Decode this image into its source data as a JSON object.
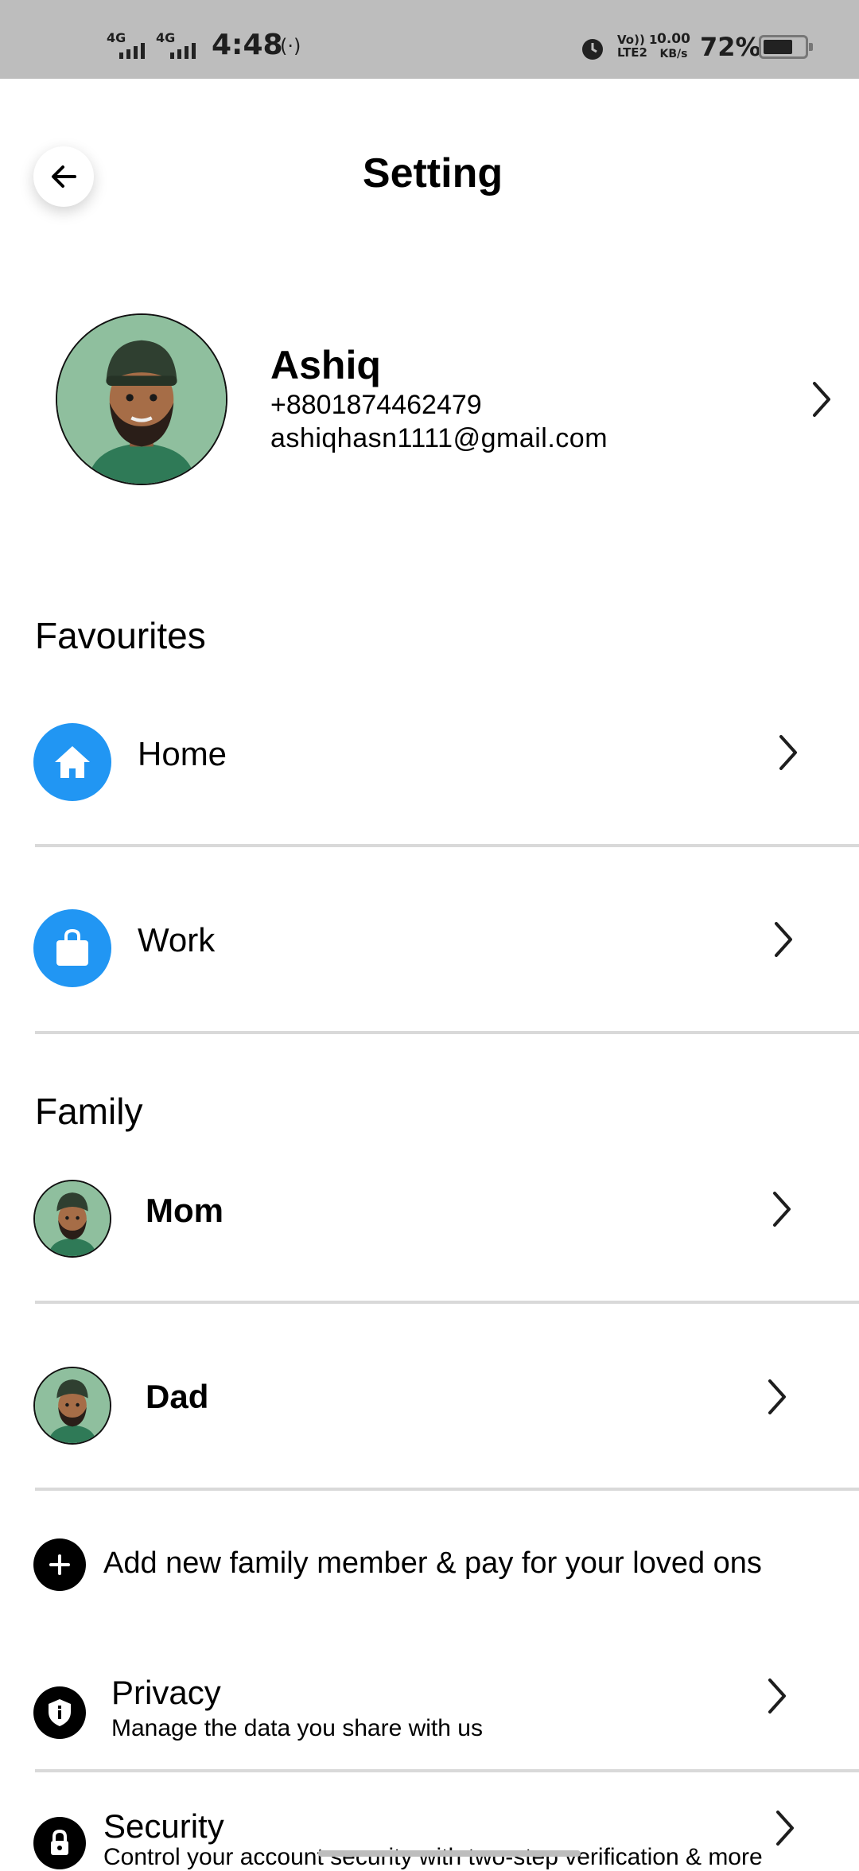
{
  "status_bar": {
    "network_1": "4G",
    "network_2": "4G",
    "time": "4:48",
    "volte_1": "Vo)) 1",
    "volte_2": "LTE2",
    "speed_value": "0.00",
    "speed_unit": "KB/s",
    "battery": "72%",
    "battery_level": 0.72
  },
  "header": {
    "title": "Setting"
  },
  "profile": {
    "name": "Ashiq",
    "phone": "+8801874462479",
    "email": "ashiqhasn1111@gmail.com"
  },
  "favourites": {
    "title": "Favourites",
    "items": [
      {
        "label": "Home",
        "icon": "home-icon"
      },
      {
        "label": "Work",
        "icon": "briefcase-icon"
      }
    ]
  },
  "family": {
    "title": "Family",
    "members": [
      {
        "label": "Mom"
      },
      {
        "label": "Dad"
      }
    ],
    "add_label": "Add new family member & pay for your loved ons"
  },
  "settings": {
    "privacy": {
      "title": "Privacy",
      "subtitle": "Manage the data you share with us"
    },
    "security": {
      "title": "Security",
      "subtitle": "Control your account security with two-step verification & more"
    }
  },
  "colors": {
    "accent": "#2196f3",
    "status_bar": "#bdbdbd",
    "divider": "#d9d9d9"
  }
}
